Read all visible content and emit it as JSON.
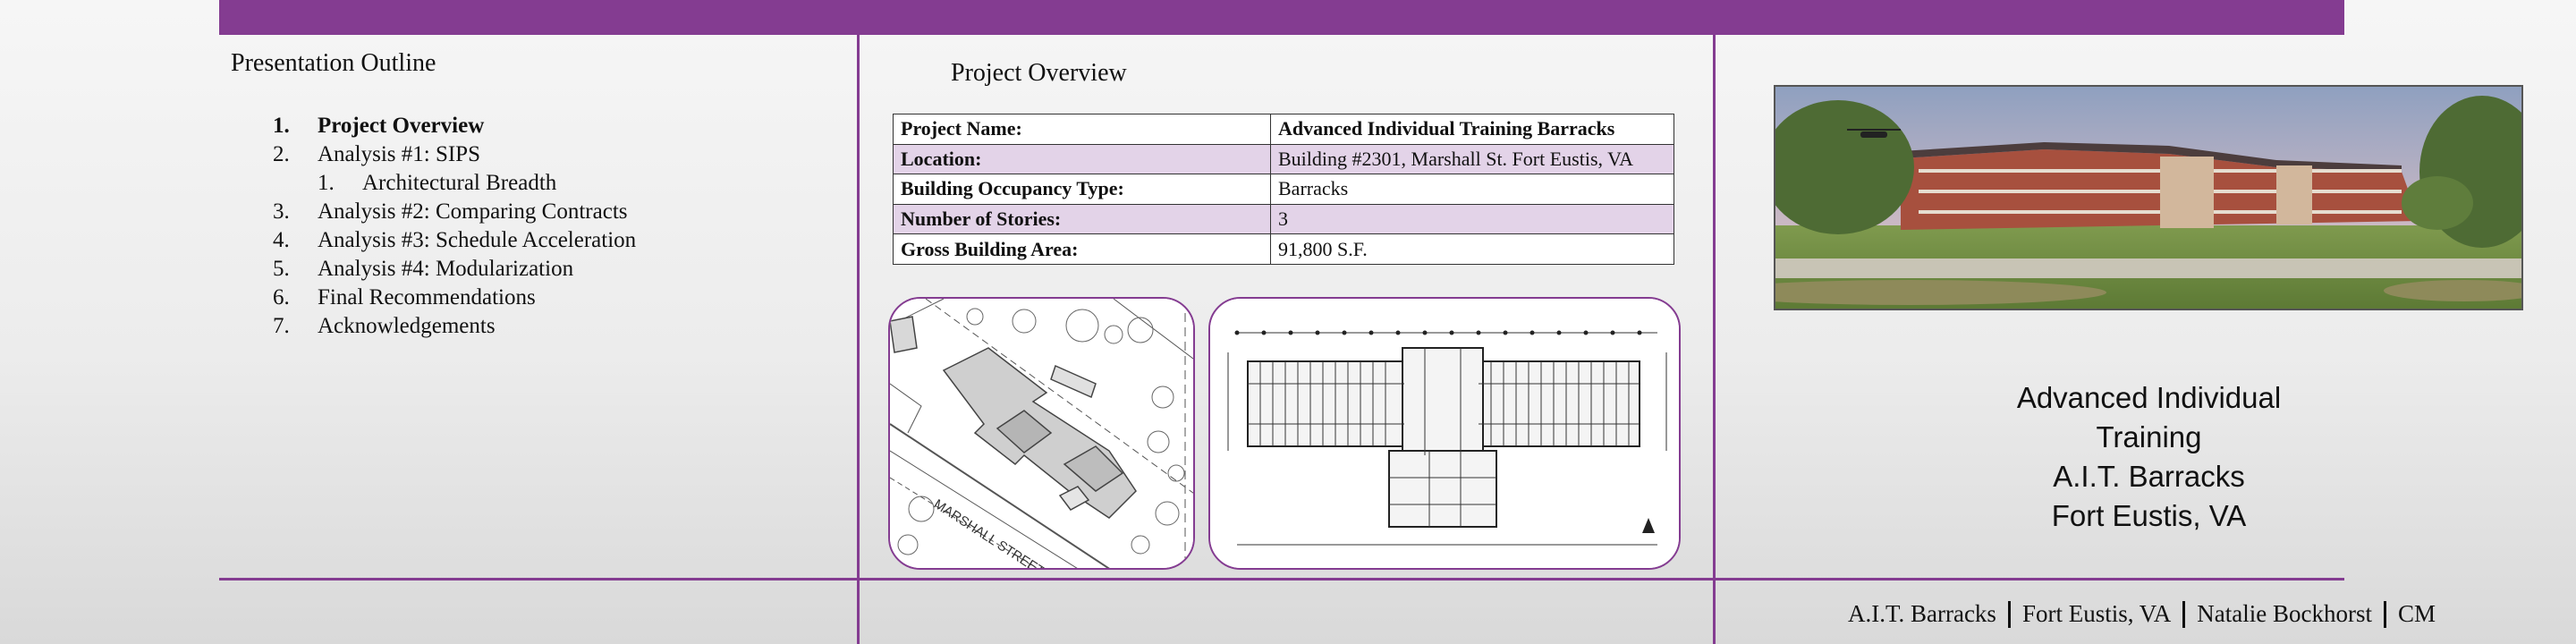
{
  "outline": {
    "title": "Presentation Outline",
    "items": [
      {
        "num": "1.",
        "label": "Project Overview"
      },
      {
        "num": "2.",
        "label": "Analysis #1: SIPS"
      },
      {
        "num": "1.",
        "label": "Architectural Breadth"
      },
      {
        "num": "3.",
        "label": "Analysis #2: Comparing Contracts"
      },
      {
        "num": "4.",
        "label": "Analysis #3: Schedule Acceleration"
      },
      {
        "num": "5.",
        "label": "Analysis #4: Modularization"
      },
      {
        "num": "6.",
        "label": "Final Recommendations"
      },
      {
        "num": "7.",
        "label": "Acknowledgements"
      }
    ]
  },
  "overview": {
    "title": "Project Overview",
    "rows": [
      {
        "key": "Project Name:",
        "value": "Advanced Individual Training Barracks"
      },
      {
        "key": "Location:",
        "value": "Building #2301, Marshall St. Fort Eustis, VA"
      },
      {
        "key": "Building Occupancy Type:",
        "value": "Barracks"
      },
      {
        "key": "Number of Stories:",
        "value": "3"
      },
      {
        "key": "Gross Building Area:",
        "value": "91,800 S.F."
      }
    ],
    "site_plan_street_label": "MARSHALL STREET"
  },
  "project_name": {
    "line1": "Advanced Individual",
    "line2": "Training",
    "line3": "A.I.T. Barracks",
    "line4": "Fort Eustis, VA"
  },
  "footer": {
    "project": "A.I.T. Barracks",
    "location": "Fort Eustis, VA",
    "author": "Natalie Bockhorst",
    "option": "CM"
  },
  "colors": {
    "accent": "#843c91",
    "table_shade": "#e3d3e8"
  }
}
